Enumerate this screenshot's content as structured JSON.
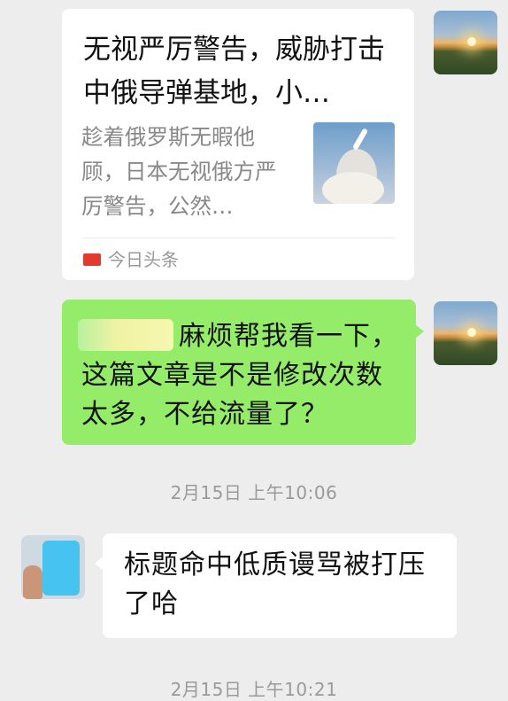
{
  "shared_article": {
    "title": "无视严厉警告，威胁打击中俄导弹基地，小…",
    "description": "趁着俄罗斯无暇他顾，日本无视俄方严厉警告，公然…",
    "thumbnail_icon": "missile-launch-image",
    "source_badge": "头条",
    "source_name": "今日头条"
  },
  "messages": [
    {
      "sender": "self",
      "text": "麻烦帮我看一下，这篇文章是不是修改次数太多，不给流量了？"
    },
    {
      "sender": "other",
      "text": "标题命中低质谩骂被打压了哈"
    }
  ],
  "timestamps": [
    "2月15日 上午10:06",
    "2月15日 上午10:21"
  ],
  "colors": {
    "background": "#ededed",
    "self_bubble": "#95ec69",
    "other_bubble": "#ffffff",
    "source_badge": "#e33a2f"
  }
}
